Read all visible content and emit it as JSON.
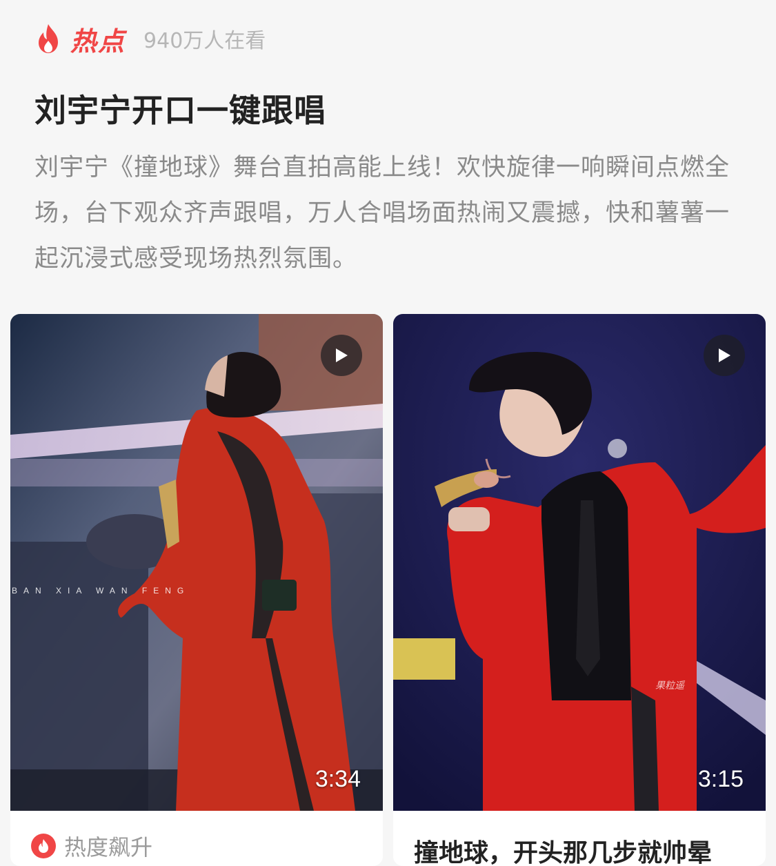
{
  "header": {
    "icon": "flame-icon",
    "hot_label": "热点",
    "viewers": "940万人在看",
    "accent_color": "#f04646"
  },
  "topic": {
    "title": "刘宇宁开口一键跟唱",
    "description": "刘宇宁《撞地球》舞台直拍高能上线！欢快旋律一响瞬间点燃全场，台下观众齐声跟唱，万人合唱场面热闹又震撼，快和薯薯一起沉浸式感受现场热烈氛围。"
  },
  "videos": [
    {
      "duration": "3:34",
      "watermark": "BAN XIA WAN FENG",
      "footer_icon": "flame-icon",
      "footer_text": "热度飙升"
    },
    {
      "duration": "3:15",
      "watermark": "果粒遥",
      "title": "撞地球，开头那几步就帅晕"
    }
  ]
}
